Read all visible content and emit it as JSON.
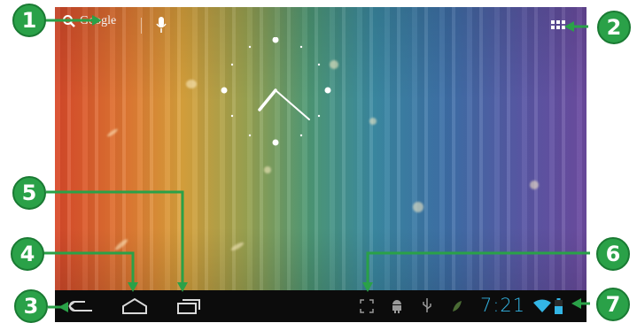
{
  "search": {
    "label": "Google"
  },
  "status": {
    "time": "7:21"
  },
  "callouts": [
    "1",
    "2",
    "3",
    "4",
    "5",
    "6",
    "7"
  ],
  "colors": {
    "callout": "#2aa148",
    "time": "#33b5e5",
    "navbar": "#0c0c0c"
  },
  "icons": [
    "search-icon",
    "microphone-icon",
    "all-apps-icon",
    "back-icon",
    "home-icon",
    "recent-apps-icon",
    "screenshot-icon",
    "android-debug-icon",
    "usb-icon",
    "notification-leaf-icon",
    "wifi-icon",
    "battery-icon"
  ]
}
